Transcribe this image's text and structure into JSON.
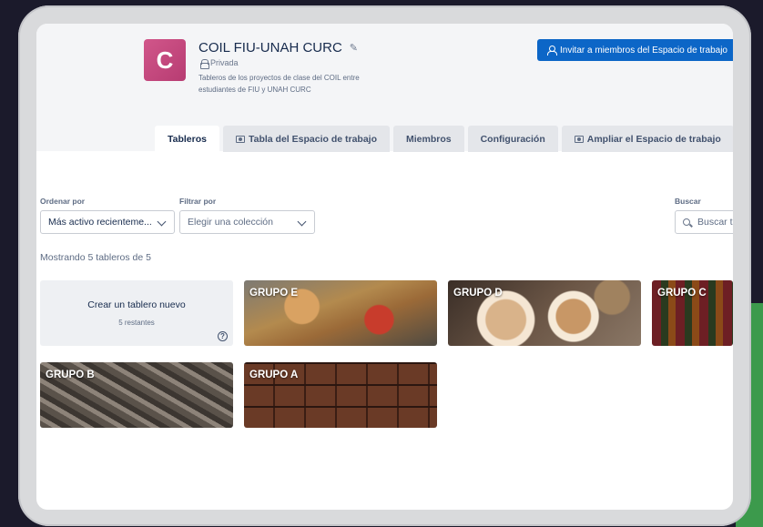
{
  "workspace": {
    "initial": "C",
    "name": "COIL FIU-UNAH CURC",
    "visibility": "Privada",
    "description": "Tableros de los proyectos de clase del COIL entre estudiantes de FIU y UNAH CURC",
    "avatar_color": "#c94a80"
  },
  "header": {
    "invite_label": "Invitar a miembros del Espacio de trabajo",
    "invite_color": "#0c66c7"
  },
  "tabs": [
    {
      "label": "Tableros",
      "active": true
    },
    {
      "label": "Tabla del Espacio de trabajo",
      "icon": "table-icon"
    },
    {
      "label": "Miembros"
    },
    {
      "label": "Configuración"
    },
    {
      "label": "Ampliar el Espacio de trabajo",
      "icon": "upgrade-icon"
    }
  ],
  "filters": {
    "sort_label": "Ordenar por",
    "sort_value": "Más activo recienteme...",
    "filter_label": "Filtrar por",
    "filter_placeholder": "Elegir una colección",
    "search_label": "Buscar",
    "search_placeholder": "Buscar tableros"
  },
  "summary": "Mostrando 5 tableros de 5",
  "create_board": {
    "label": "Crear un tablero nuevo",
    "remaining": "5 restantes"
  },
  "boards": [
    {
      "title": "GRUPO E"
    },
    {
      "title": "GRUPO D"
    },
    {
      "title": "GRUPO C"
    },
    {
      "title": "GRUPO B"
    },
    {
      "title": "GRUPO A"
    }
  ]
}
